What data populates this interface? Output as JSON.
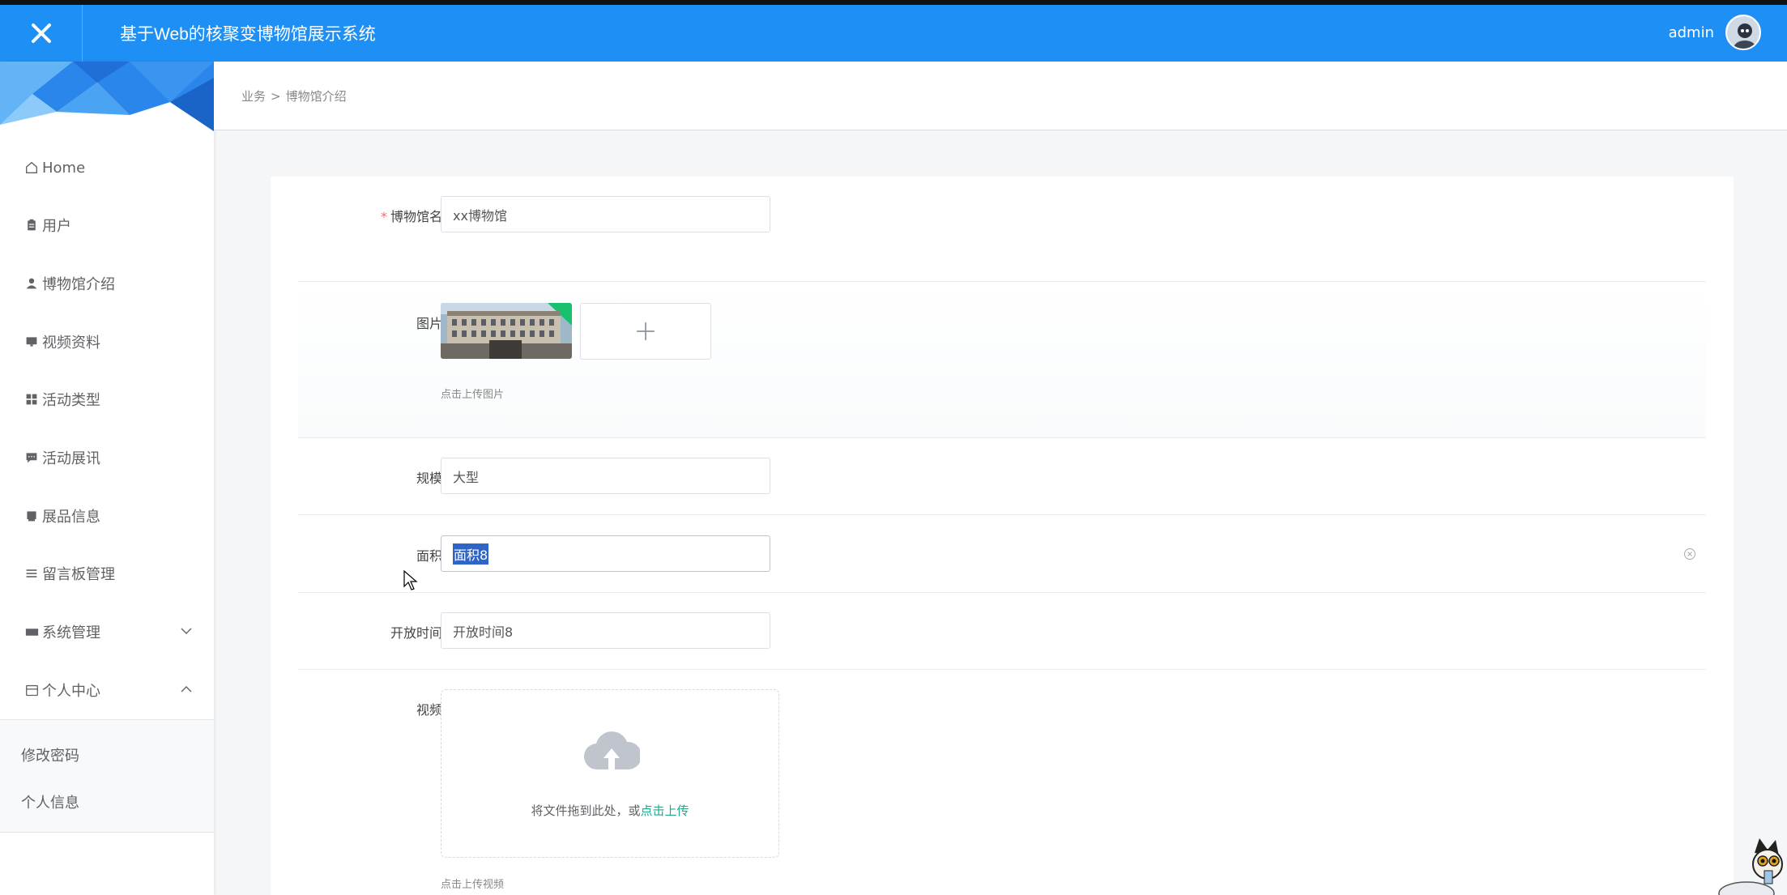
{
  "header": {
    "title": "基于Web的核聚变博物馆展示系统",
    "username": "admin"
  },
  "sidebar": {
    "items": [
      {
        "label": "Home",
        "icon": "home-icon"
      },
      {
        "label": "用户",
        "icon": "clipboard-icon"
      },
      {
        "label": "博物馆介绍",
        "icon": "user-icon"
      },
      {
        "label": "视频资料",
        "icon": "monitor-icon"
      },
      {
        "label": "活动类型",
        "icon": "grid-icon"
      },
      {
        "label": "活动展讯",
        "icon": "chat-icon"
      },
      {
        "label": "展品信息",
        "icon": "inbox-icon"
      },
      {
        "label": "留言板管理",
        "icon": "list-icon"
      },
      {
        "label": "系统管理",
        "icon": "ticket-icon",
        "expanded": false
      },
      {
        "label": "个人中心",
        "icon": "wallet-icon",
        "expanded": true
      }
    ],
    "submenu": [
      {
        "label": "修改密码"
      },
      {
        "label": "个人信息"
      }
    ]
  },
  "breadcrumb": {
    "parent": "业务",
    "separator": ">",
    "current": "博物馆介绍"
  },
  "form": {
    "name": {
      "label": "博物馆名",
      "value": "xx博物馆",
      "required": true
    },
    "image": {
      "label": "图片",
      "hint": "点击上传图片"
    },
    "scale": {
      "label": "规模",
      "value": "大型"
    },
    "area": {
      "label": "面积",
      "value": "面积8"
    },
    "open_time": {
      "label": "开放时间",
      "value": "开放时间8"
    },
    "video": {
      "label": "视频",
      "drop_text": "将文件拖到此处，或",
      "drop_link": "点击上传",
      "hint": "点击上传视频"
    }
  },
  "colors": {
    "header_bg": "#1e90f5",
    "required": "#f56c6c",
    "link": "#1fa88d",
    "selection": "#2f64c8"
  }
}
